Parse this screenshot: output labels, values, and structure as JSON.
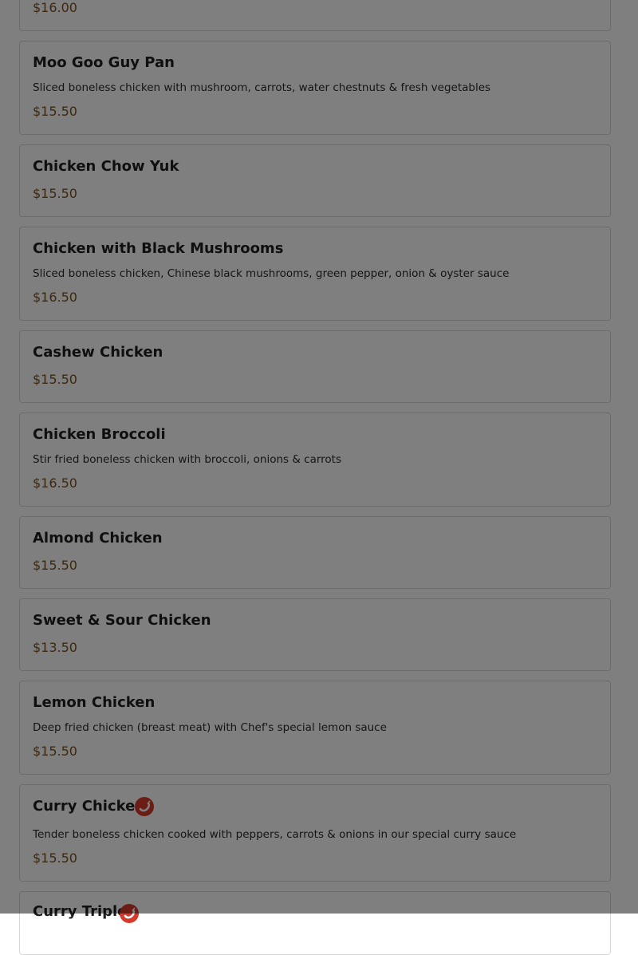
{
  "menu_items": [
    {
      "price": "$16.00"
    },
    {
      "name": "Moo Goo Guy Pan",
      "description": "Sliced boneless chicken with mushroom, carrots, water chestnuts & fresh vegetables",
      "price": "$15.50"
    },
    {
      "name": "Chicken Chow Yuk",
      "price": "$15.50"
    },
    {
      "name": "Chicken with Black Mushrooms",
      "description": "Sliced boneless chicken, Chinese black mushrooms, green pepper, onion & oyster sauce",
      "price": "$16.50"
    },
    {
      "name": "Cashew Chicken",
      "price": "$15.50"
    },
    {
      "name": "Chicken Broccoli",
      "description": "Stir fried boneless chicken with broccoli, onions & carrots",
      "price": "$16.50"
    },
    {
      "name": "Almond Chicken",
      "price": "$15.50"
    },
    {
      "name": "Sweet & Sour Chicken",
      "price": "$13.50"
    },
    {
      "name": "Lemon Chicken",
      "description": "Deep fried chicken (breast meat) with Chef's special lemon sauce",
      "price": "$15.50"
    },
    {
      "name": "Curry Chicken",
      "description": "Tender boneless chicken cooked with peppers, carrots & onions in our special curry sauce",
      "price": "$15.50",
      "icon": "spicy-chili-icon"
    },
    {
      "name": "Curry Triple",
      "icon": "spicy-chili-icon"
    }
  ]
}
